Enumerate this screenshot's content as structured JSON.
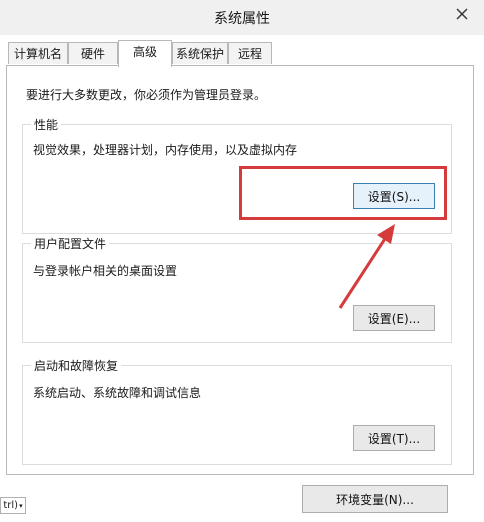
{
  "window": {
    "title": "系统属性"
  },
  "tabs": [
    {
      "label": "计算机名"
    },
    {
      "label": "硬件"
    },
    {
      "label": "高级"
    },
    {
      "label": "系统保护"
    },
    {
      "label": "远程"
    }
  ],
  "admin_note": "要进行大多数更改，你必须作为管理员登录。",
  "performance": {
    "title": "性能",
    "description": "视觉效果，处理器计划，内存使用，以及虚拟内存",
    "button": "设置(S)..."
  },
  "user_profiles": {
    "title": "用户配置文件",
    "description": "与登录帐户相关的桌面设置",
    "button": "设置(E)..."
  },
  "startup_recovery": {
    "title": "启动和故障恢复",
    "description": "系统启动、系统故障和调试信息",
    "button": "设置(T)..."
  },
  "env_button": "环境变量(N)...",
  "corner_chip": "trl)",
  "colors": {
    "annotation": "#d63b3b",
    "focus_border": "#3c7fb1"
  }
}
